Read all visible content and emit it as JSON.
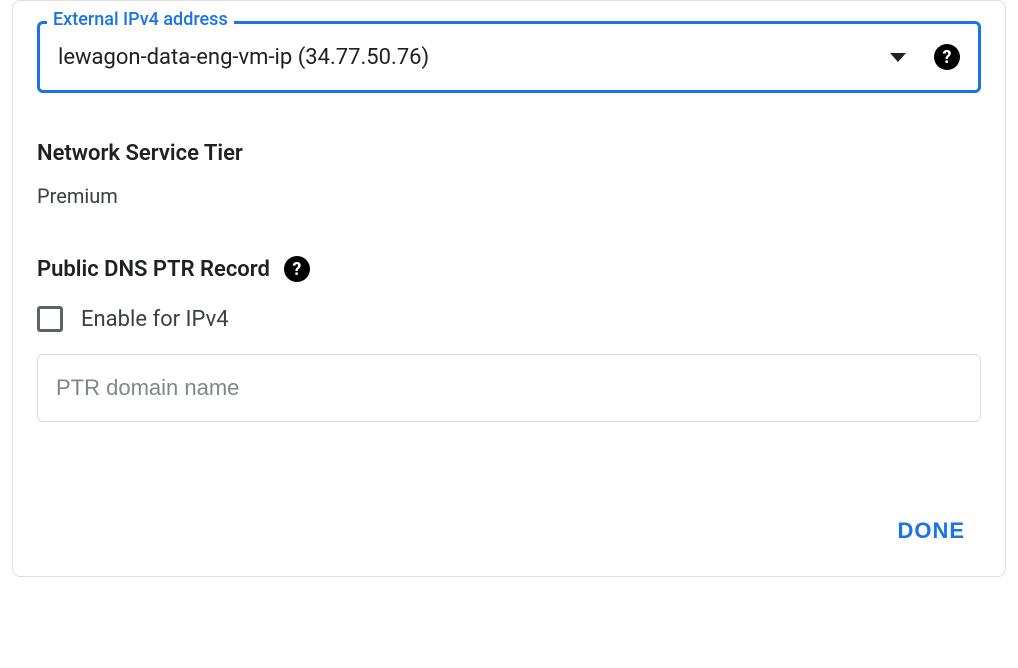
{
  "external_ip": {
    "label": "External IPv4 address",
    "selected": "lewagon-data-eng-vm-ip (34.77.50.76)"
  },
  "network_tier": {
    "heading": "Network Service Tier",
    "value": "Premium"
  },
  "ptr": {
    "heading": "Public DNS PTR Record",
    "checkbox_label": "Enable for IPv4",
    "input_placeholder": "PTR domain name"
  },
  "footer": {
    "done": "DONE"
  }
}
